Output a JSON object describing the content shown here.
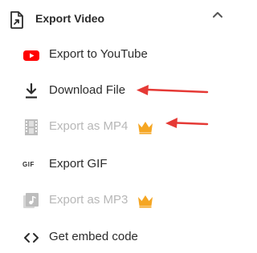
{
  "header": {
    "title": "Export Video"
  },
  "items": [
    {
      "label": "Export to YouTube",
      "icon": "youtube-icon",
      "enabled": true
    },
    {
      "label": "Download File",
      "icon": "download-icon",
      "enabled": true
    },
    {
      "label": "Export as MP4",
      "icon": "film-icon",
      "enabled": false,
      "premium": true
    },
    {
      "label": "Export GIF",
      "icon": "gif-icon",
      "icon_text": "GIF",
      "enabled": true
    },
    {
      "label": "Export as MP3",
      "icon": "music-icon",
      "enabled": false,
      "premium": true
    },
    {
      "label": "Get embed code",
      "icon": "embed-code-icon",
      "enabled": true
    }
  ],
  "colors": {
    "youtube": "#ff0000",
    "crown": "#f5a623",
    "arrow": "#e53935",
    "disabled": "#b7b7b7",
    "text": "#2b2b2b"
  }
}
